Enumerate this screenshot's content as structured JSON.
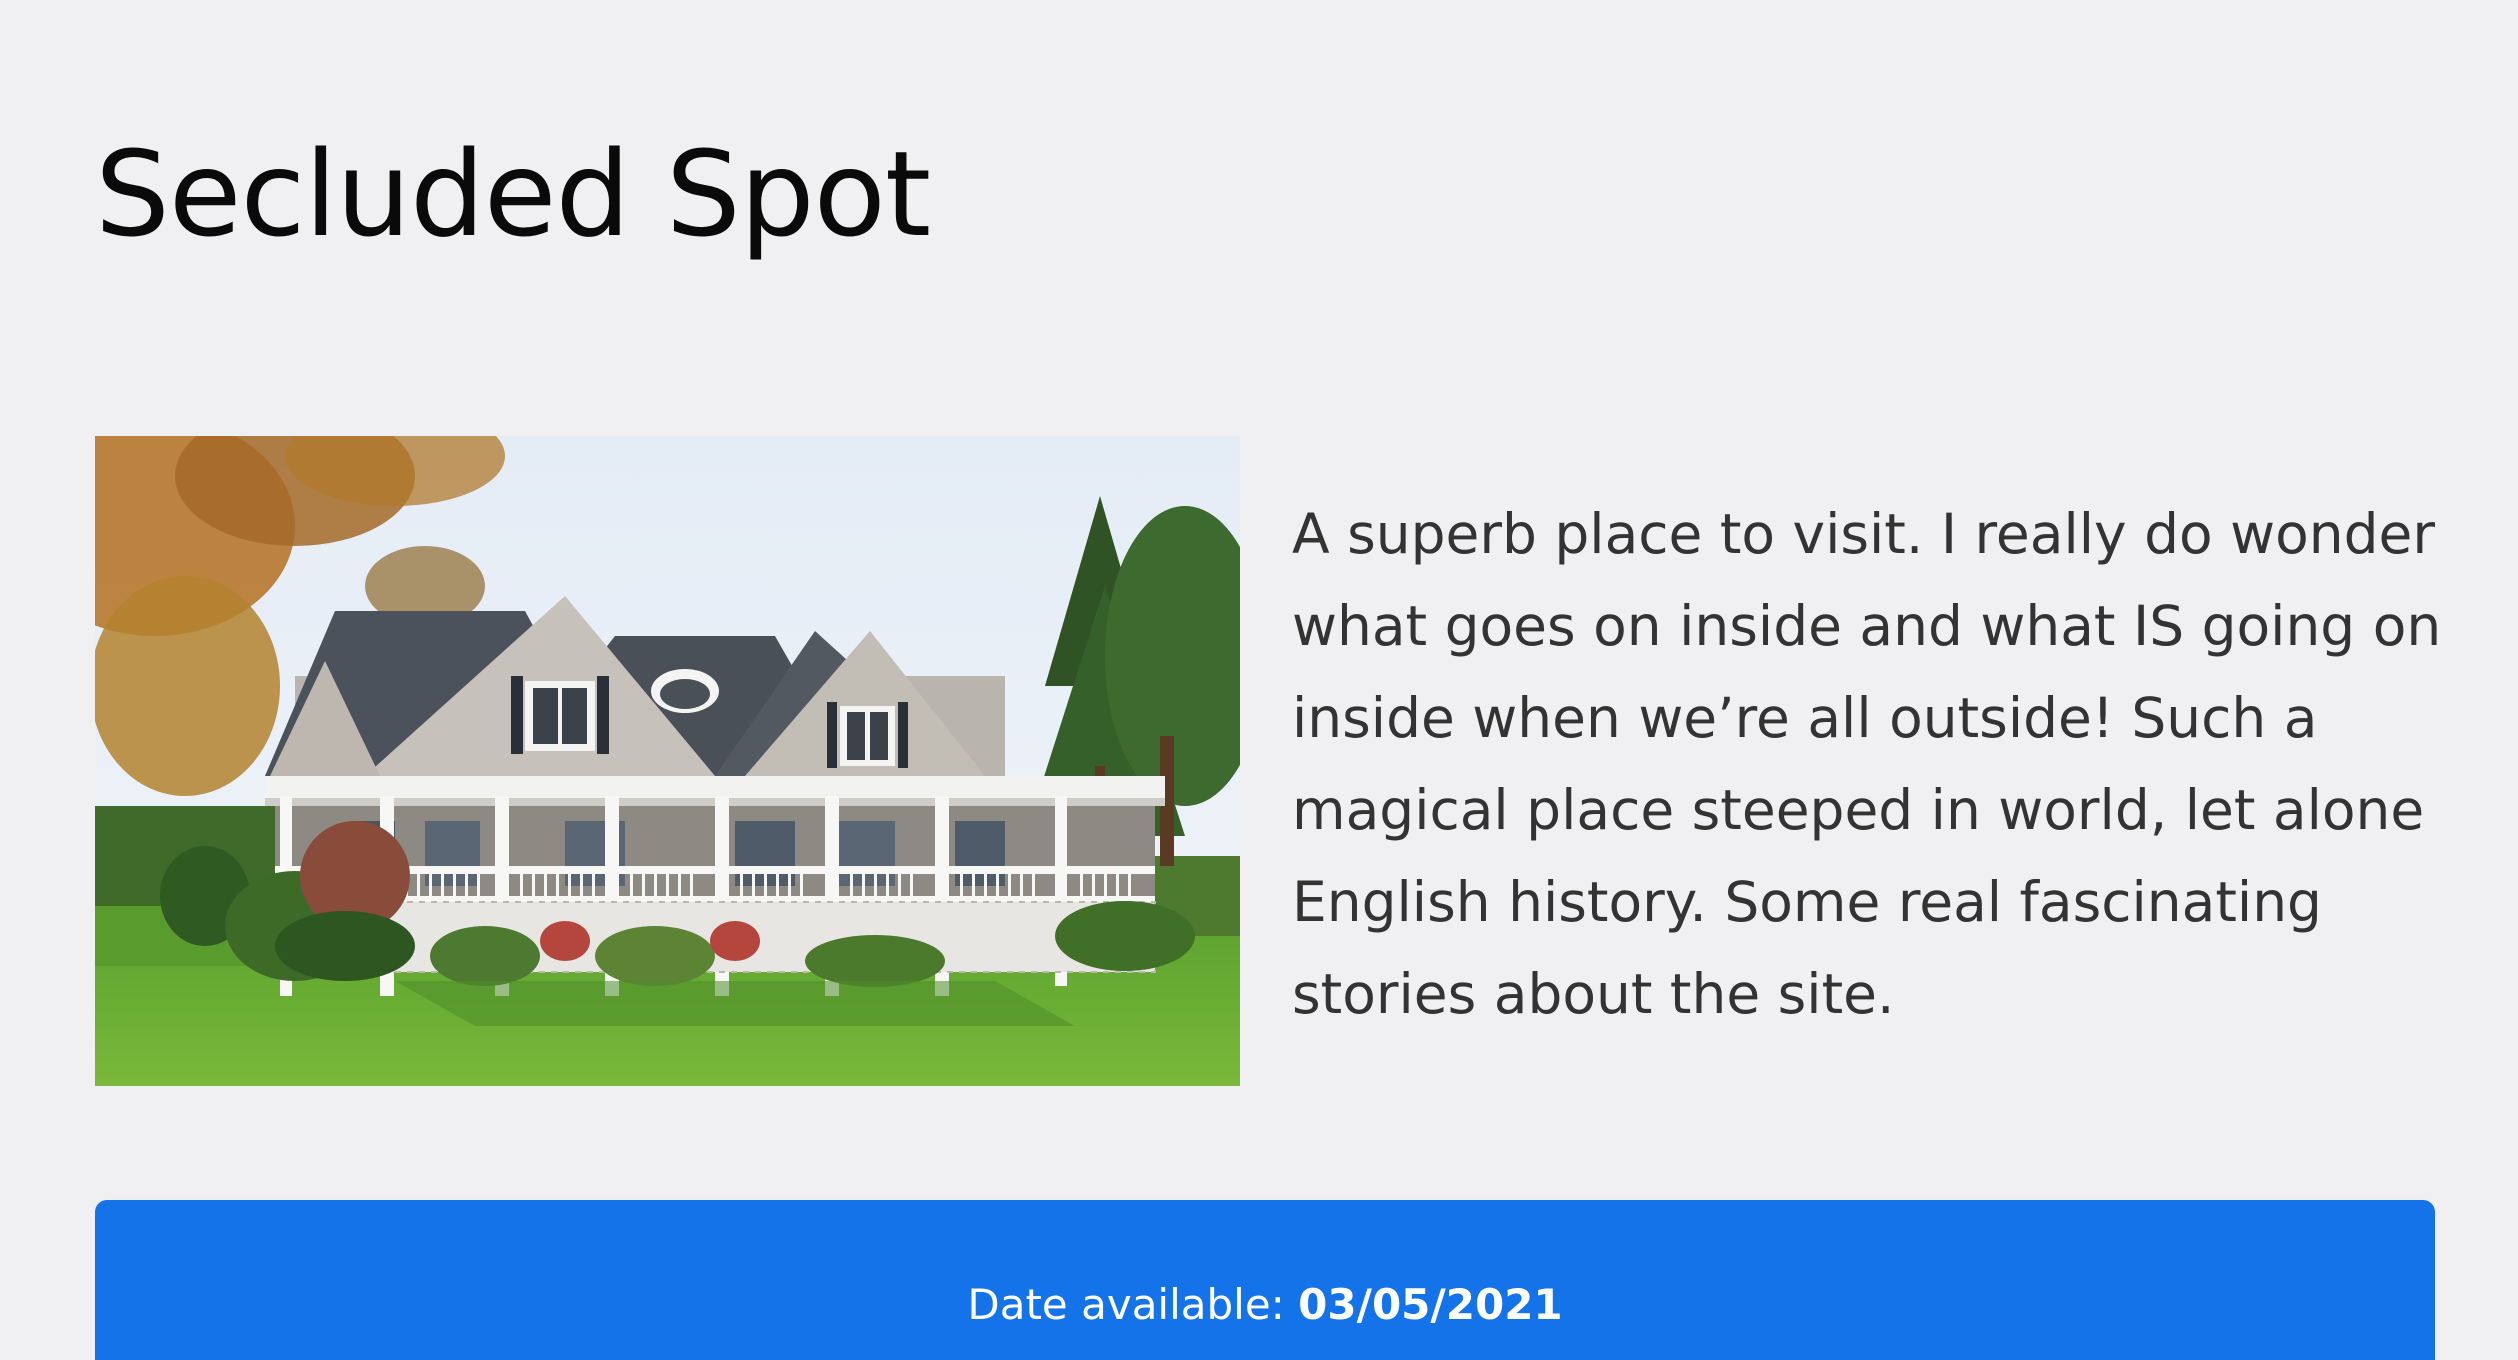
{
  "listing": {
    "title": "Secluded Spot",
    "image_icon": "house-photo",
    "description": "A superb place to visit. I really do wonder what goes on inside and what IS going on inside when we’re all outside! Such a magical place steeped in world, let alone English history. Some real fascinating stories about the site.",
    "availability_label": "Date available: ",
    "availability_date": "03/05/2021"
  },
  "colors": {
    "background": "#f0f0f2",
    "banner": "#1573ea",
    "banner_text": "#ffffff",
    "body_text": "#333333"
  }
}
